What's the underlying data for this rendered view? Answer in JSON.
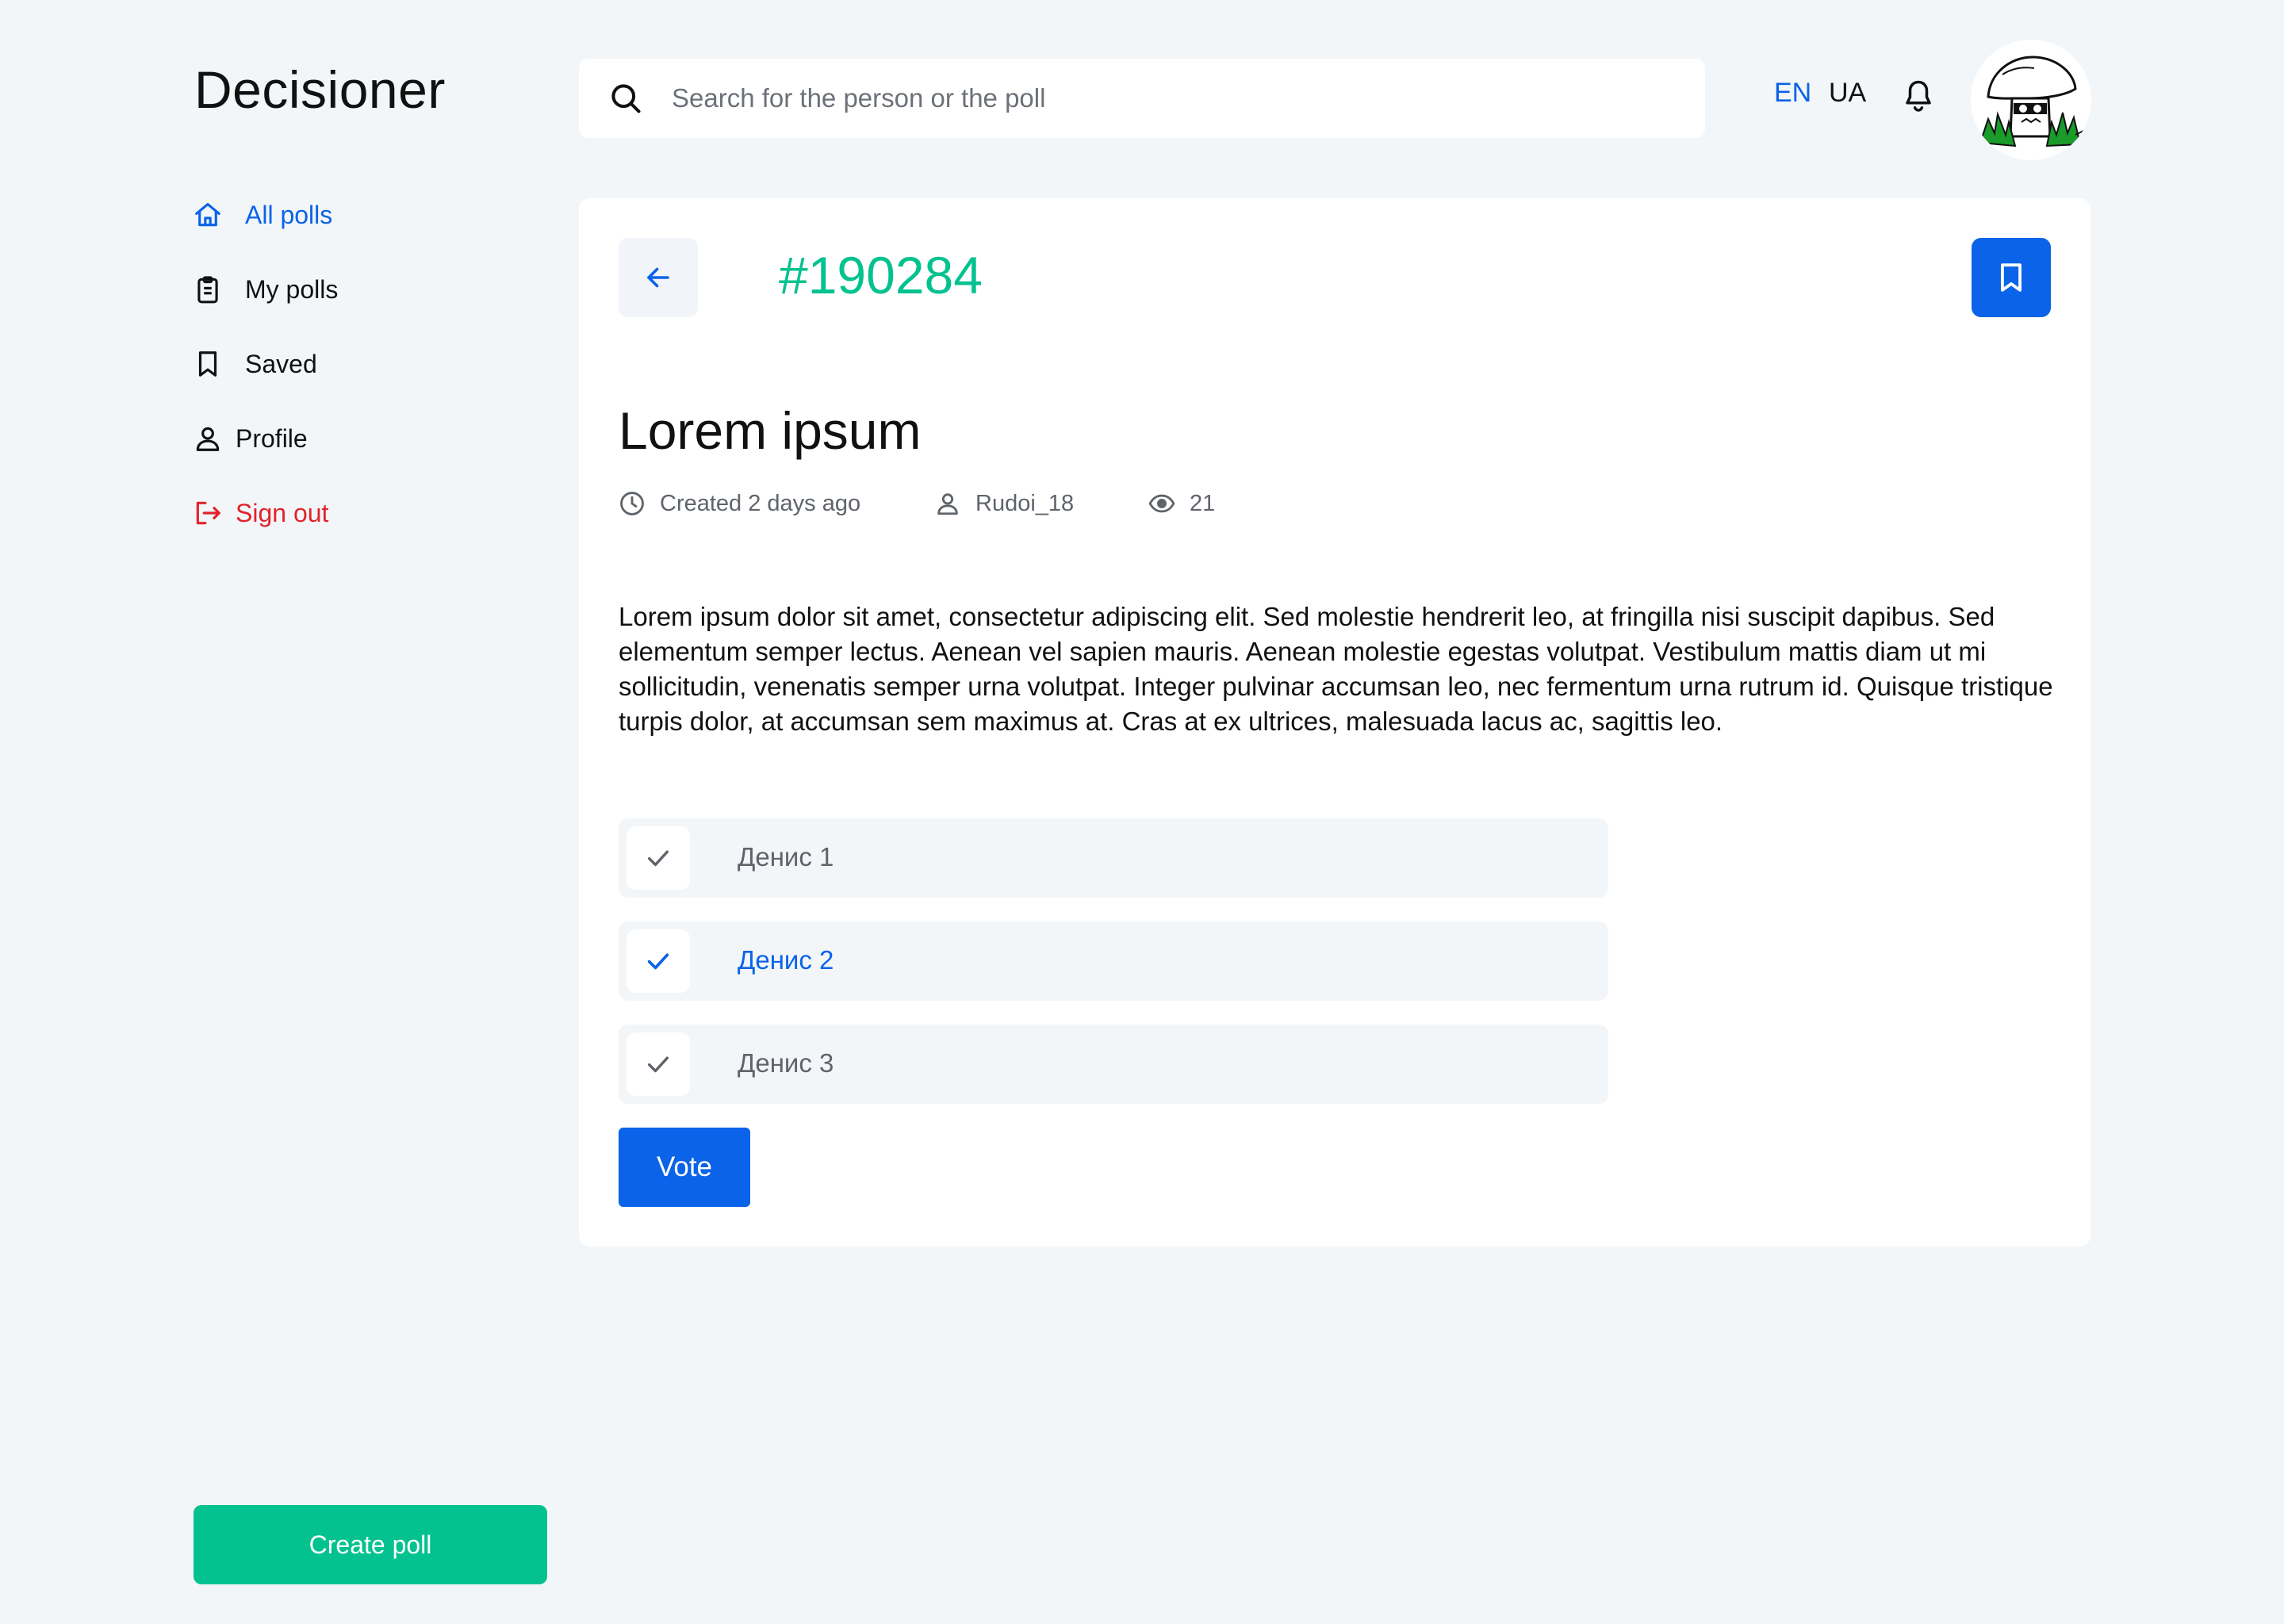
{
  "app": {
    "title": "Decisioner"
  },
  "search": {
    "placeholder": "Search for the person or the poll"
  },
  "languages": {
    "en": "EN",
    "ua": "UA",
    "active": "EN"
  },
  "header": {
    "bell_icon": "bell-icon",
    "avatar": "user-avatar"
  },
  "sidebar": {
    "items": [
      {
        "label": "All polls",
        "icon": "home-icon",
        "active": true
      },
      {
        "label": "My polls",
        "icon": "clipboard-icon"
      },
      {
        "label": "Saved",
        "icon": "bookmark-icon"
      },
      {
        "label": "Profile",
        "icon": "user-icon"
      },
      {
        "label": "Sign out",
        "icon": "sign-out-icon",
        "danger": true
      }
    ],
    "create_label": "Create poll"
  },
  "poll": {
    "id": "#190284",
    "title": "Lorem ipsum",
    "created": "Created 2 days ago",
    "author": "Rudoi_18",
    "views": "21",
    "description": "Lorem ipsum dolor sit amet, consectetur adipiscing elit. Sed molestie hendrerit leo, at fringilla nisi suscipit dapibus. Sed elementum semper lectus. Aenean vel sapien mauris. Aenean molestie egestas volutpat. Vestibulum mattis diam ut mi sollicitudin, venenatis semper urna volutpat. Integer pulvinar accumsan leo, nec fermentum urna rutrum id. Quisque tristique turpis dolor, at accumsan sem maximus at. Cras at ex ultrices, malesuada lacus ac, sagittis leo.",
    "options": [
      {
        "label": "Денис 1",
        "selected": false
      },
      {
        "label": "Денис 2",
        "selected": true
      },
      {
        "label": "Денис 3",
        "selected": false
      }
    ],
    "vote_label": "Vote"
  },
  "colors": {
    "accent": "#0a63e8",
    "brand_green": "#04c28f",
    "danger": "#e0242b",
    "background": "#f3f6f9"
  }
}
